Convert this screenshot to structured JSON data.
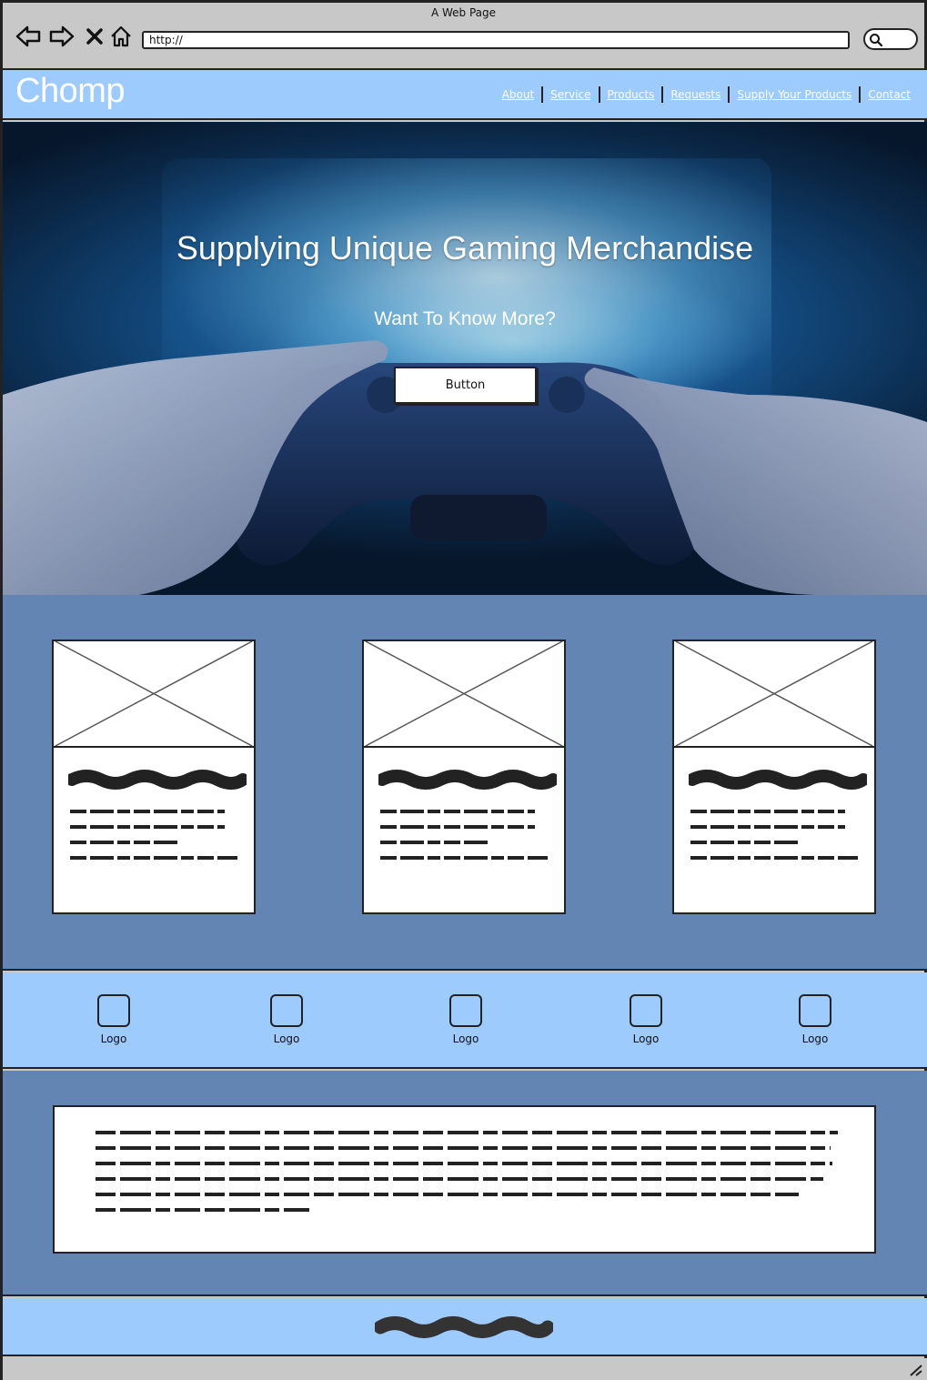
{
  "window": {
    "title": "A Web Page",
    "url": "http://"
  },
  "header": {
    "brand": "Chomp",
    "menu": [
      "About",
      "Service",
      "Products",
      "Requests",
      "Supply Your Products",
      "Contact"
    ]
  },
  "hero": {
    "title": "Supplying Unique Gaming Merchandise",
    "subtitle": "Want To Know More?",
    "button": "Button"
  },
  "logos": [
    "Logo",
    "Logo",
    "Logo",
    "Logo",
    "Logo"
  ],
  "colors": {
    "header_bg": "#9dcbfd",
    "section_bg": "#6285b4",
    "chrome_bg": "#c8c8c8"
  }
}
